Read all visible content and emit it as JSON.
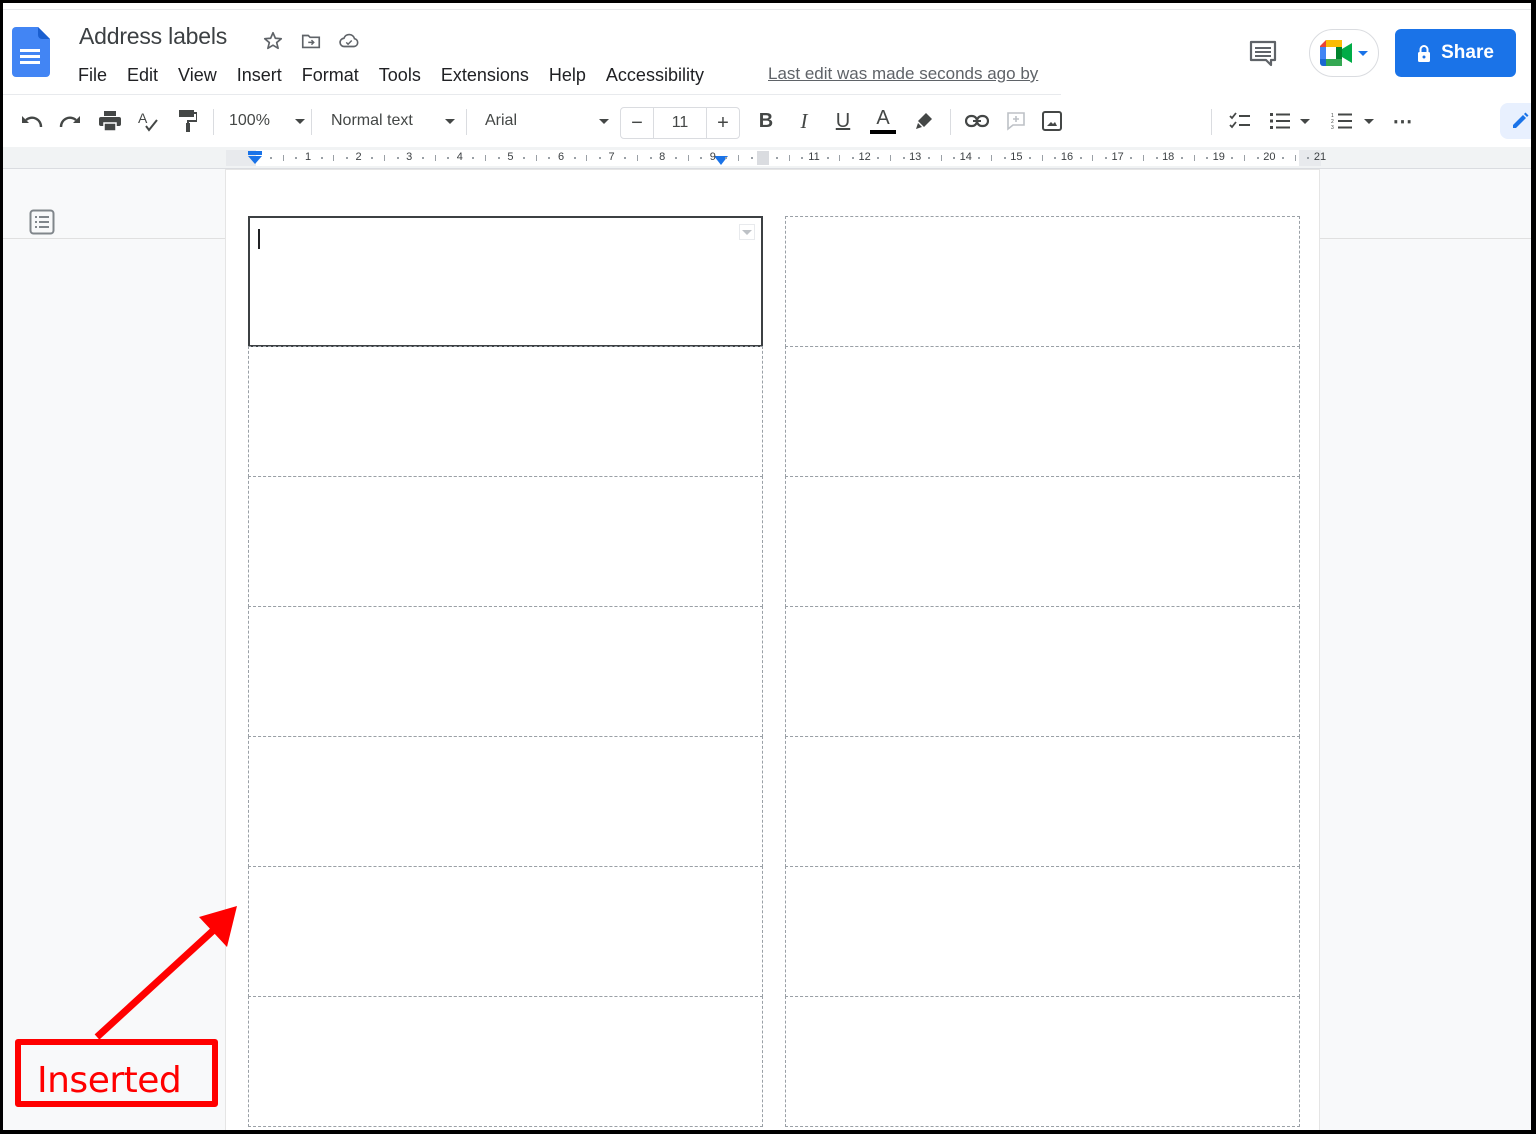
{
  "app": {
    "doc_title": "Address labels",
    "title_icons": [
      "star-icon",
      "move-to-folder-icon",
      "cloud-saved-icon"
    ],
    "menu": [
      "File",
      "Edit",
      "View",
      "Insert",
      "Format",
      "Tools",
      "Extensions",
      "Help",
      "Accessibility"
    ],
    "last_edit": "Last edit was made seconds ago by",
    "share_label": "Share",
    "colors": {
      "accent": "#1a73e8",
      "annotation": "#ff0000"
    }
  },
  "toolbar": {
    "zoom": "100%",
    "style": "Normal text",
    "font": "Arial",
    "font_size": "11",
    "decrease_label": "−",
    "increase_label": "+",
    "bold": "B",
    "italic": "I",
    "underline": "U",
    "text_color": "A",
    "text_color_value": "#000000",
    "more": "⋯"
  },
  "ruler": {
    "numbers": [
      "1",
      "2",
      "3",
      "4",
      "5",
      "6",
      "7",
      "8",
      "9",
      "11",
      "12",
      "13",
      "14",
      "15",
      "16",
      "17",
      "18",
      "19",
      "20",
      "21"
    ]
  },
  "labels": {
    "columns": 2,
    "rows": 7,
    "active_cell": [
      0,
      0
    ]
  },
  "annotation": {
    "text": "Inserted"
  }
}
